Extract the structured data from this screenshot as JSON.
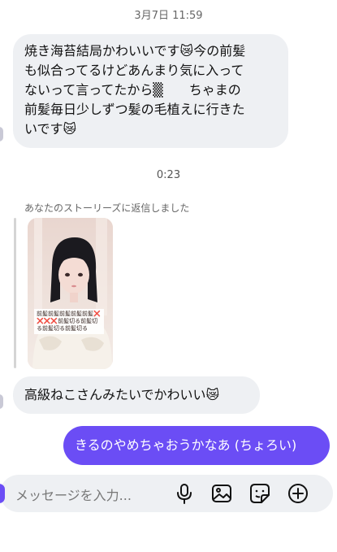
{
  "thread": {
    "timestamp_1": "3月7日 11:59",
    "message_1_lines": [
      "焼き海苔結局かわいいです😿今の前髪",
      "も似合ってるけどあんまり気に入って",
      "ないって言ってたから▒　　ちゃまの",
      "前髪毎日少しずつ髪の毛植えに行きた",
      "いです😿"
    ],
    "timestamp_2": "0:23",
    "story_reply_label": "あなたのストーリーズに返信しました",
    "story_overlay_text": "前髪前髪前髪前髪前髪❌❌❌❌前髪切る前髪切る前髪切る前髪切る",
    "message_2": "高級ねこさんみたいでかわいい😿",
    "sent_message": "きるのやめちゃおうかなあ (ちょろい)"
  },
  "composer": {
    "placeholder": "メッセージを入力...",
    "icons": [
      "microphone-icon",
      "image-icon",
      "sticker-icon",
      "plus-icon"
    ]
  },
  "colors": {
    "incoming_bubble": "#eef0f3",
    "outgoing_bubble": "#6b4df5"
  }
}
